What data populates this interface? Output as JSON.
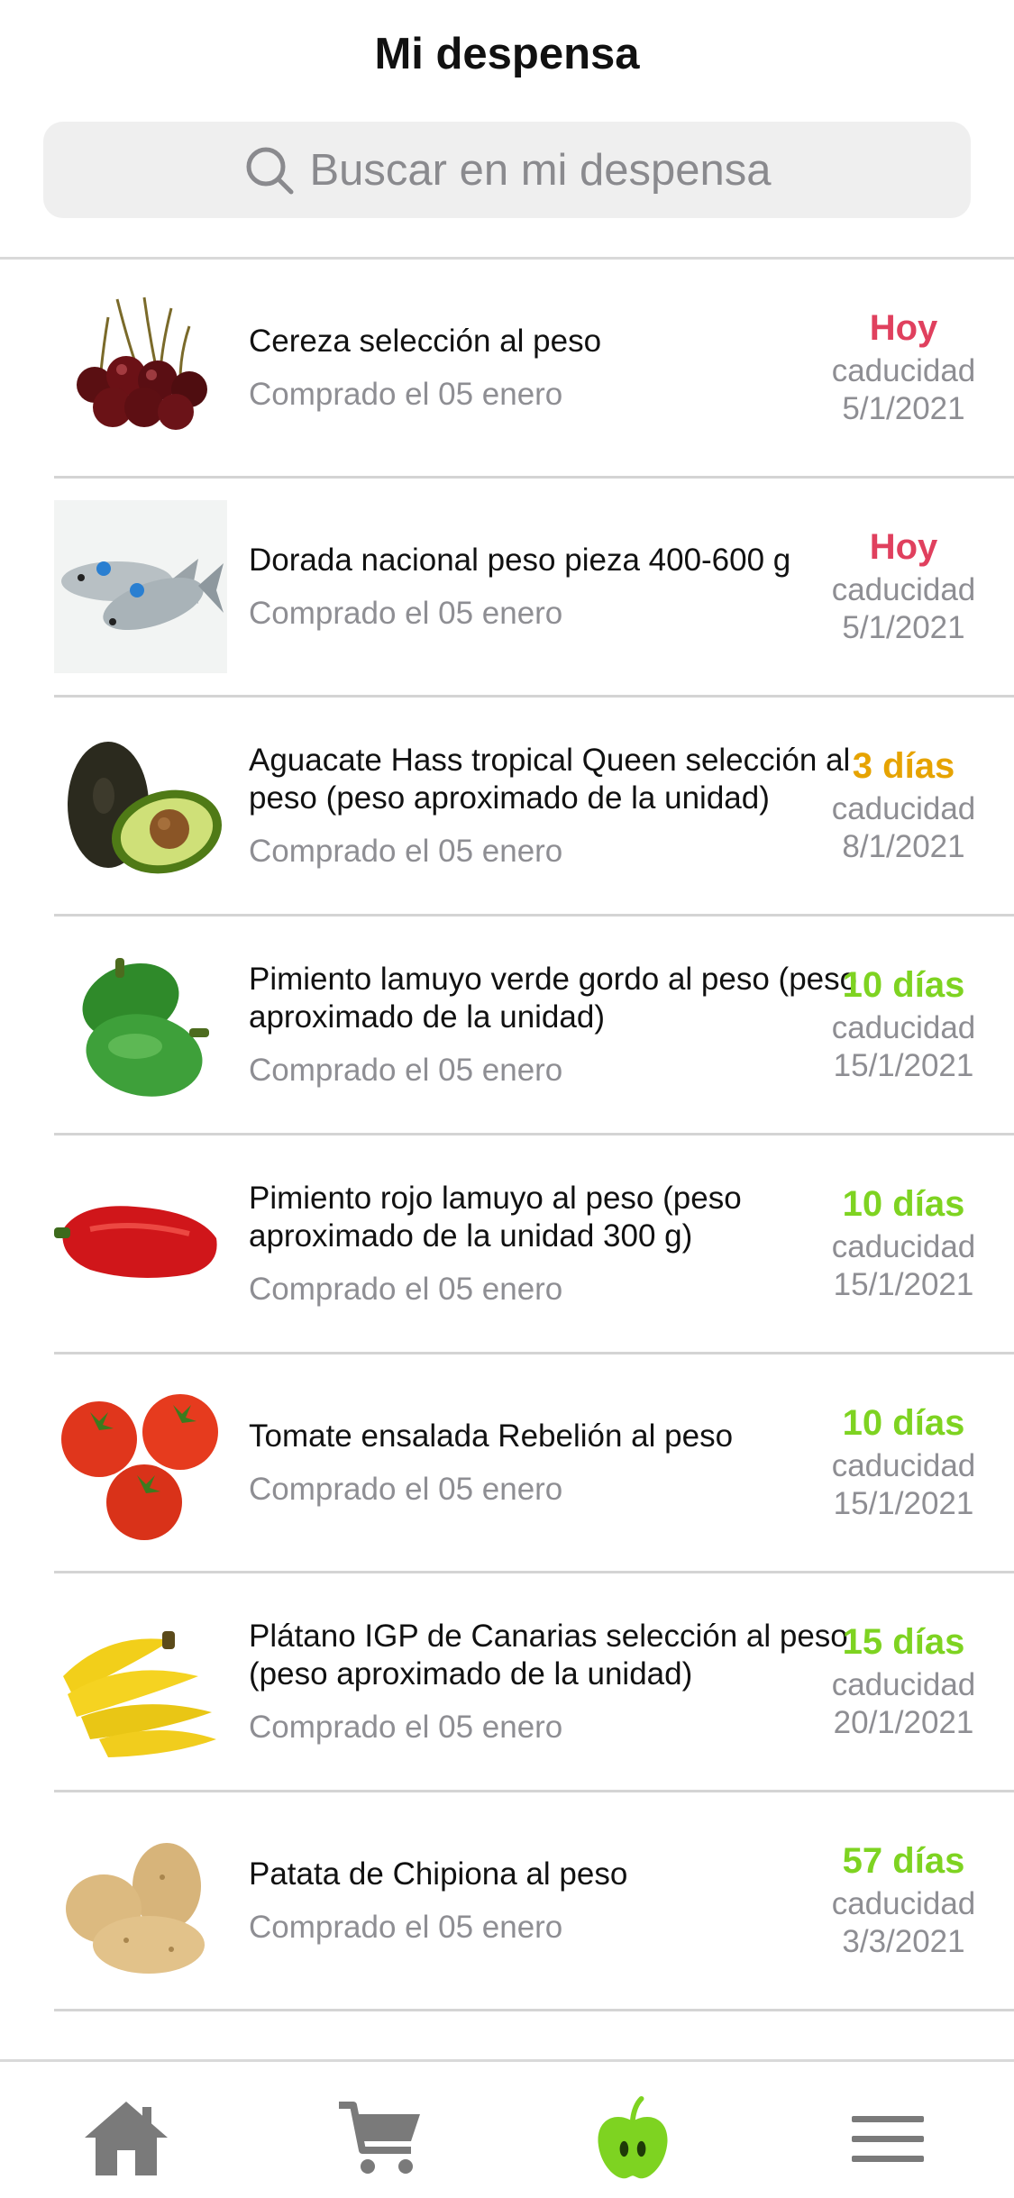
{
  "header": {
    "title": "Mi despensa",
    "search_placeholder": "Buscar en mi despensa"
  },
  "colors": {
    "today": "#e0405e",
    "soon": "#e6a300",
    "ok": "#7ed321",
    "muted": "#8e8e93"
  },
  "items": [
    {
      "name": "Cereza selección al peso",
      "bought": "Comprado el 05 enero",
      "days": "Hoy",
      "status": "today",
      "cad_label": "caducidad",
      "date": "5/1/2021",
      "icon": "cherries-image"
    },
    {
      "name": "Dorada nacional peso pieza 400-600 g",
      "bought": "Comprado el 05 enero",
      "days": "Hoy",
      "status": "today",
      "cad_label": "caducidad",
      "date": "5/1/2021",
      "icon": "fish-image"
    },
    {
      "name": "Aguacate Hass tropical Queen selección al peso (peso aproximado de la unidad)",
      "bought": "Comprado el 05 enero",
      "days": "3 días",
      "status": "soon",
      "cad_label": "caducidad",
      "date": "8/1/2021",
      "icon": "avocado-image"
    },
    {
      "name": "Pimiento lamuyo verde gordo al peso (peso aproximado de la unidad)",
      "bought": "Comprado el 05 enero",
      "days": "10 días",
      "status": "ok",
      "cad_label": "caducidad",
      "date": "15/1/2021",
      "icon": "green-pepper-image"
    },
    {
      "name": "Pimiento rojo lamuyo al peso (peso aproximado de la unidad 300 g)",
      "bought": "Comprado el 05 enero",
      "days": "10 días",
      "status": "ok",
      "cad_label": "caducidad",
      "date": "15/1/2021",
      "icon": "red-pepper-image"
    },
    {
      "name": "Tomate ensalada Rebelión al peso",
      "bought": "Comprado el 05 enero",
      "days": "10 días",
      "status": "ok",
      "cad_label": "caducidad",
      "date": "15/1/2021",
      "icon": "tomato-image"
    },
    {
      "name": "Plátano IGP de Canarias selección al peso (peso aproximado de la unidad)",
      "bought": "Comprado el 05 enero",
      "days": "15 días",
      "status": "ok",
      "cad_label": "caducidad",
      "date": "20/1/2021",
      "icon": "banana-image"
    },
    {
      "name": "Patata de Chipiona al peso",
      "bought": "Comprado el 05 enero",
      "days": "57 días",
      "status": "ok",
      "cad_label": "caducidad",
      "date": "3/3/2021",
      "icon": "potato-image"
    }
  ],
  "tabbar": {
    "tabs": [
      {
        "icon": "home-icon",
        "active": false
      },
      {
        "icon": "cart-icon",
        "active": false
      },
      {
        "icon": "apple-icon",
        "active": true
      },
      {
        "icon": "menu-icon",
        "active": false
      }
    ],
    "active_color": "#7ed321",
    "inactive_color": "#7a7a7a"
  }
}
